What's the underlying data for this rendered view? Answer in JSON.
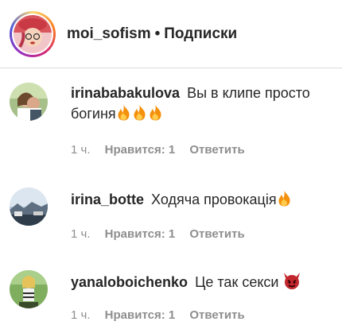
{
  "header": {
    "username": "moi_sofism",
    "separator": "•",
    "follow_label": "Подписки"
  },
  "comments": [
    {
      "username": "irinababakulova",
      "text": "Вы в клипе просто богиня",
      "emoji": "fire-icon x3",
      "time": "1 ч.",
      "likes": "Нравится: 1",
      "reply": "Ответить"
    },
    {
      "username": "irina_botte",
      "text": "Ходяча провокація",
      "emoji": "fire-icon",
      "time": "1 ч.",
      "likes": "Нравится: 1",
      "reply": "Ответить"
    },
    {
      "username": "yanaloboichenko",
      "text": "Це так секси",
      "emoji": "smiling-devil-icon",
      "time": "1 ч.",
      "likes": "Нравится: 1",
      "reply": "Ответить"
    }
  ],
  "colors": {
    "text": "#262626",
    "meta": "#8e8e8e",
    "divider": "#dbdbdb",
    "fire": "#f4900c",
    "devil": "#c1272d"
  }
}
